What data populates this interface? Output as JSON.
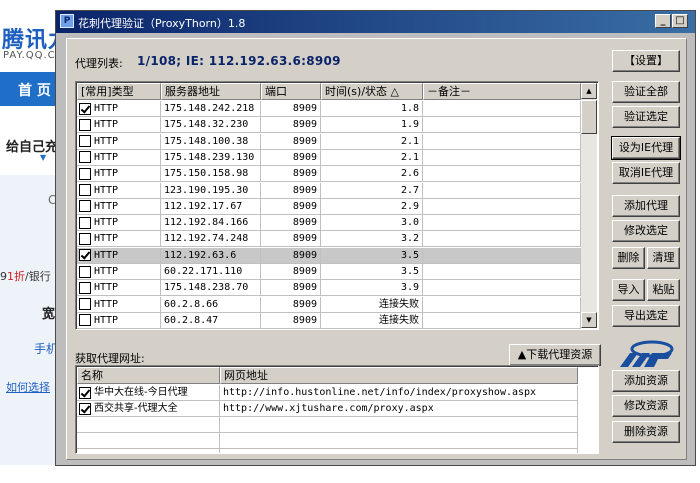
{
  "background_page": {
    "logo_text": "腾讯九",
    "logo_sub": "PAY.QQ.C",
    "nav_home": "首 页",
    "slogan": "给自己充",
    "c_letter": "C",
    "discount_prefix": "9",
    "discount_red": "1折",
    "discount_suffix": "/银行",
    "kuan": "宽",
    "phone": "手机",
    "how": "如何选择"
  },
  "window": {
    "title": "花刺代理验证（ProxyThorn）1.8",
    "minimize": "_",
    "maximize": "□"
  },
  "proxy_list": {
    "label": "代理列表:",
    "info": "1/108;  IE: 112.192.63.6:8909",
    "columns": [
      "[常用]类型",
      "服务器地址",
      "端口",
      "时间(s)/状态 △",
      "－备注－"
    ],
    "rows": [
      {
        "checked": true,
        "type": "HTTP",
        "address": "175.148.242.218",
        "port": "8909",
        "status": "1.8",
        "note": ""
      },
      {
        "checked": false,
        "type": "HTTP",
        "address": "175.148.32.230",
        "port": "8909",
        "status": "1.9",
        "note": ""
      },
      {
        "checked": false,
        "type": "HTTP",
        "address": "175.148.100.38",
        "port": "8909",
        "status": "2.1",
        "note": ""
      },
      {
        "checked": false,
        "type": "HTTP",
        "address": "175.148.239.130",
        "port": "8909",
        "status": "2.1",
        "note": ""
      },
      {
        "checked": false,
        "type": "HTTP",
        "address": "175.150.158.98",
        "port": "8909",
        "status": "2.6",
        "note": ""
      },
      {
        "checked": false,
        "type": "HTTP",
        "address": "123.190.195.30",
        "port": "8909",
        "status": "2.7",
        "note": ""
      },
      {
        "checked": false,
        "type": "HTTP",
        "address": "112.192.17.67",
        "port": "8909",
        "status": "2.9",
        "note": ""
      },
      {
        "checked": false,
        "type": "HTTP",
        "address": "112.192.84.166",
        "port": "8909",
        "status": "3.0",
        "note": ""
      },
      {
        "checked": false,
        "type": "HTTP",
        "address": "112.192.74.248",
        "port": "8909",
        "status": "3.2",
        "note": ""
      },
      {
        "checked": true,
        "type": "HTTP",
        "address": "112.192.63.6",
        "port": "8909",
        "status": "3.5",
        "note": "",
        "selected": true
      },
      {
        "checked": false,
        "type": "HTTP",
        "address": "60.22.171.110",
        "port": "8909",
        "status": "3.5",
        "note": ""
      },
      {
        "checked": false,
        "type": "HTTP",
        "address": "175.148.238.70",
        "port": "8909",
        "status": "3.9",
        "note": ""
      },
      {
        "checked": false,
        "type": "HTTP",
        "address": "60.2.8.66",
        "port": "8909",
        "status": "连接失败",
        "note": ""
      },
      {
        "checked": false,
        "type": "HTTP",
        "address": "60.2.8.47",
        "port": "8909",
        "status": "连接失败",
        "note": ""
      }
    ]
  },
  "buttons": {
    "settings": "【设置】",
    "verify_all": "验证全部",
    "verify_selected": "验证选定",
    "set_ie_proxy": "设为IE代理",
    "cancel_ie_proxy": "取消IE代理",
    "add_proxy": "添加代理",
    "edit_selected": "修改选定",
    "delete": "删除",
    "clean": "清理",
    "import": "导入",
    "paste": "粘贴",
    "export_selected": "导出选定",
    "download_resources": "▲下载代理资源",
    "add_resource": "添加资源",
    "edit_resource": "修改资源",
    "delete_resource": "删除资源"
  },
  "sources": {
    "label": "获取代理网址:",
    "columns": [
      "名称",
      "网页地址"
    ],
    "rows": [
      {
        "checked": true,
        "name": "华中大在线-今日代理",
        "url": "http://info.hustonline.net/info/index/proxyshow.aspx"
      },
      {
        "checked": true,
        "name": "西交共享-代理大全",
        "url": "http://www.xjtushare.com/proxy.aspx"
      }
    ]
  },
  "colors": {
    "title_start": "#0a246a",
    "title_end": "#3a6ea5",
    "face": "#d4d0c8",
    "logo_blue": "#1a4fa0"
  }
}
